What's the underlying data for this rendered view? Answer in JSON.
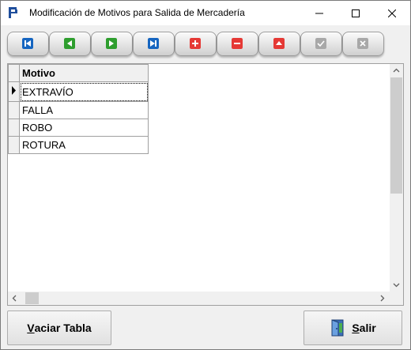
{
  "window": {
    "title": "Modificación de Motivos para Salida de Mercadería",
    "icon": "app-icon",
    "controls": [
      "minimize-icon",
      "maximize-icon",
      "close-icon"
    ]
  },
  "toolbar": {
    "buttons": [
      {
        "name": "first-record",
        "icon": "first-record-icon",
        "color": "#1565c0",
        "enabled": true
      },
      {
        "name": "prior-record",
        "icon": "prior-record-icon",
        "color": "#2e9e2e",
        "enabled": true
      },
      {
        "name": "next-record",
        "icon": "next-record-icon",
        "color": "#2e9e2e",
        "enabled": true
      },
      {
        "name": "last-record",
        "icon": "last-record-icon",
        "color": "#1565c0",
        "enabled": true
      },
      {
        "name": "insert-record",
        "icon": "plus-icon",
        "color": "#e53935",
        "enabled": true
      },
      {
        "name": "delete-record",
        "icon": "minus-icon",
        "color": "#e53935",
        "enabled": true
      },
      {
        "name": "edit-record",
        "icon": "up-triangle-icon",
        "color": "#e53935",
        "enabled": true
      },
      {
        "name": "post-record",
        "icon": "check-icon",
        "color": "#a8a8a8",
        "enabled": false
      },
      {
        "name": "cancel-record",
        "icon": "x-icon",
        "color": "#a8a8a8",
        "enabled": false
      }
    ]
  },
  "grid": {
    "column_header": "Motivo",
    "current_row": 0,
    "rows": [
      "EXTRAVÍO",
      "FALLA",
      "ROBO",
      "ROTURA"
    ]
  },
  "buttons": {
    "vaciar_prefix": "V",
    "vaciar_rest": "aciar Tabla",
    "salir_prefix": "S",
    "salir_rest": "alir"
  }
}
